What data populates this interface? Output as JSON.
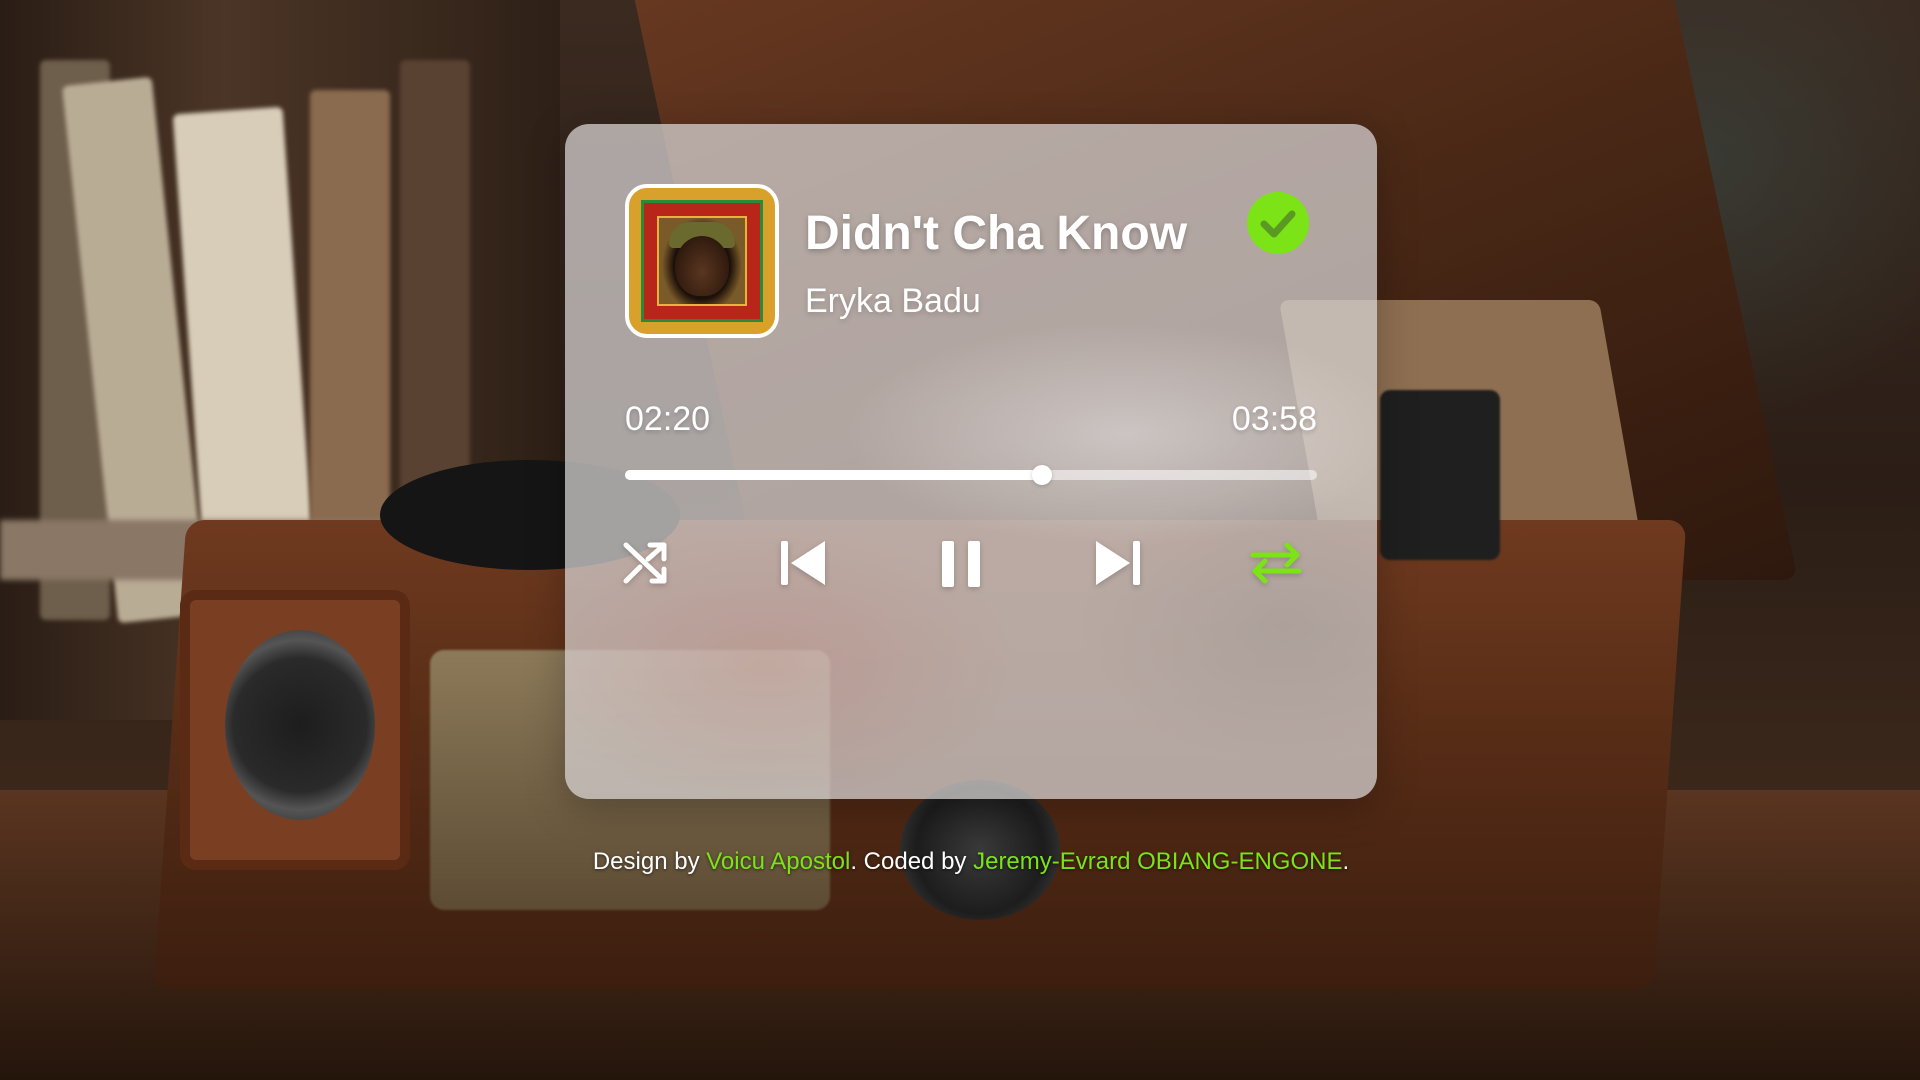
{
  "track": {
    "title": "Didn't Cha Know",
    "artist": "Eryka Badu",
    "elapsed": "02:20",
    "total": "03:58",
    "progress_fraction": 0.603,
    "liked": true,
    "repeat_active": true
  },
  "controls": {
    "shuffle_icon": "shuffle-icon",
    "previous_icon": "skip-previous-icon",
    "pause_icon": "pause-icon",
    "next_icon": "skip-next-icon",
    "repeat_icon": "repeat-icon",
    "liked_icon": "check-circle-icon"
  },
  "footer": {
    "design_prefix": "Design by ",
    "designer": "Voicu Apostol",
    "coded_prefix": ". Coded by ",
    "coder": "Jeremy-Evrard OBIANG-ENGONE",
    "suffix": "."
  },
  "colors": {
    "accent": "#7be316",
    "text": "#ffffff",
    "card": "rgba(215,210,210,0.74)"
  }
}
